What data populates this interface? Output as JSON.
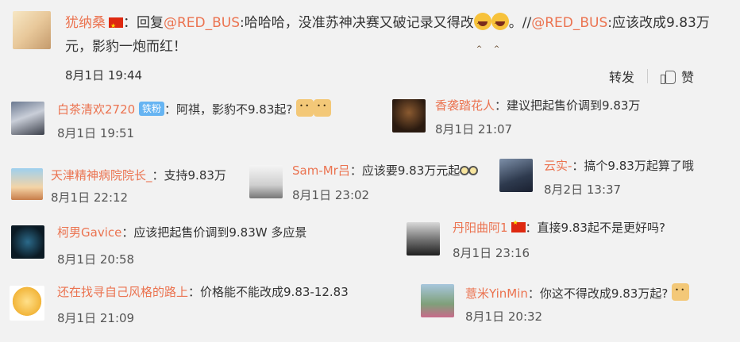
{
  "main_post": {
    "author": "犹纳桑",
    "reply_prefix": "：回复",
    "mention1": "@RED_BUS",
    "text1": ":哈哈哈，没准苏神决赛又破记录又得改",
    "text2": "。//",
    "mention2": "@RED_BUS",
    "text3": ":应该改成9.83万元，影豹一炮而红！",
    "time": "8月1日 19:44",
    "repost_label": "转发",
    "like_label": "赞"
  },
  "comments": [
    {
      "author": "白茶清欢2720",
      "badge": "铁粉",
      "text": "：阿祺，影豹不9.83起?",
      "time": "8月1日 19:51"
    },
    {
      "author": "香袭踏花人",
      "text": "：建议把起售价调到9.83万",
      "time": "8月1日 21:07"
    },
    {
      "author": "天津精神病院院长_",
      "text": "：支持9.83万",
      "time": "8月1日 22:12"
    },
    {
      "author": "Sam-Mr吕",
      "text": "：应该要9.83万元起",
      "time": "8月1日 23:02"
    },
    {
      "author": "云实-",
      "text": "：搞个9.83万起算了哦",
      "time": "8月2日 13:37"
    },
    {
      "author": "柯男Gavice",
      "text": "：应该把起售价调到9.83W 多应景",
      "time": "8月1日 20:58"
    },
    {
      "author": "丹阳曲阿1",
      "text": "：直接9.83起不是更好吗?",
      "time": "8月1日 23:16"
    },
    {
      "author": "还在找寻自己风格的路上",
      "text": "：价格能不能改成9.83-12.83",
      "time": "8月1日 21:09"
    },
    {
      "author": "薏米YinMin",
      "text": "：你这不得改成9.83万起?",
      "time": "8月1日 20:32"
    }
  ],
  "colors": {
    "username": "#eb7350",
    "badge": "#66b4f2",
    "background": "#f2f2f2"
  },
  "icons": [
    "china-flag-icon",
    "laughing-emoji-icon",
    "doge-emoji-icon",
    "glasses-emoji-icon",
    "thumbs-up-icon"
  ]
}
